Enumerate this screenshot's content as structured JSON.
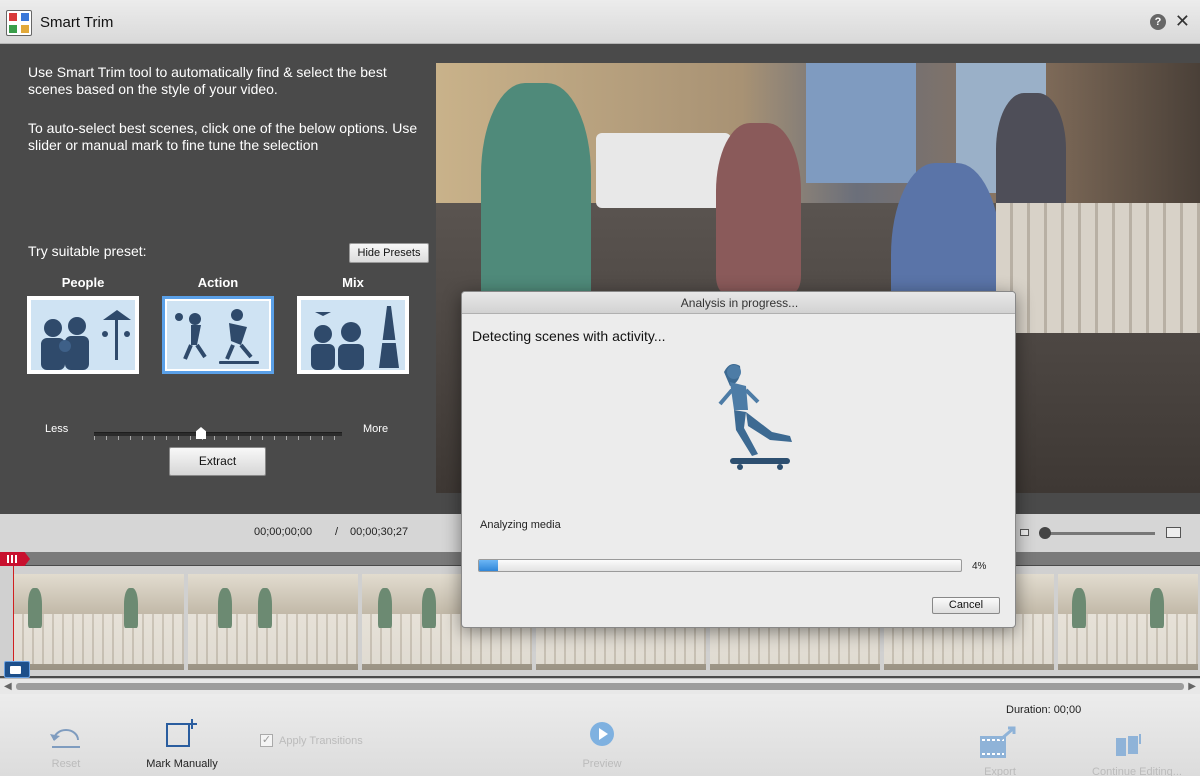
{
  "window": {
    "title": "Smart Trim",
    "help_glyph": "?",
    "close_glyph": "✕"
  },
  "intro": {
    "line1": "Use Smart Trim tool to automatically find & select the best scenes based on the style of your video.",
    "line2": "To auto-select best scenes, click one of the below options. Use slider or manual mark to fine tune the selection"
  },
  "presets": {
    "title": "Try suitable preset:",
    "hide_label": "Hide Presets",
    "items": [
      {
        "label": "People"
      },
      {
        "label": "Action"
      },
      {
        "label": "Mix"
      }
    ],
    "selected": "Action"
  },
  "slider": {
    "less_label": "Less",
    "more_label": "More",
    "value": 0.43
  },
  "extract_label": "Extract",
  "timecode": {
    "current": "00;00;00;00",
    "separator": "/",
    "total": "00;00;30;27"
  },
  "zoom": {
    "value": 0.05
  },
  "dialog": {
    "title": "Analysis in progress...",
    "message": "Detecting scenes with activity...",
    "status": "Analyzing media",
    "progress_percent": 4,
    "progress_text": "4%",
    "cancel_label": "Cancel"
  },
  "toolbar": {
    "reset_label": "Reset",
    "mark_manually_label": "Mark Manually",
    "apply_transitions_label": "Apply Transitions",
    "apply_transitions_checked": true,
    "preview_label": "Preview",
    "export_label": "Export",
    "continue_label": "Continue Editing...",
    "duration_text": "Duration: 00;00"
  },
  "colors": {
    "accent": "#2f86d8",
    "selection": "#5aa0e8",
    "playhead": "#c8102e",
    "panel": "#4a4a4a"
  },
  "icons": [
    "app-icon",
    "help-icon",
    "close-icon",
    "reset-icon",
    "mark-manually-icon",
    "checkbox-icon",
    "play-icon",
    "export-icon",
    "continue-editing-icon",
    "camera-icon"
  ]
}
